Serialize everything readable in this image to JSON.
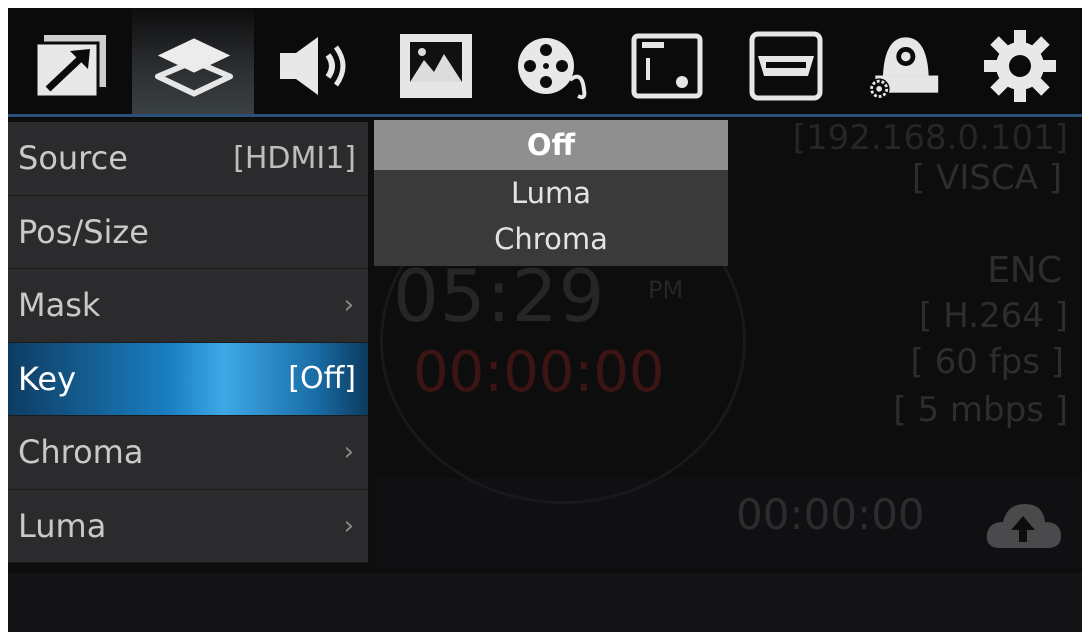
{
  "topbar": {
    "icons": [
      "window-icon",
      "layers-icon",
      "speaker-icon",
      "image-icon",
      "film-reel-icon",
      "monitor-icon",
      "hdmi-icon",
      "ptz-camera-icon",
      "gear-icon"
    ],
    "selected_index": 1
  },
  "menu": {
    "items": [
      {
        "label": "Source",
        "value": "[HDMI1]",
        "has_submenu": false
      },
      {
        "label": "Pos/Size",
        "value": "",
        "has_submenu": false
      },
      {
        "label": "Mask",
        "value": "",
        "has_submenu": true
      },
      {
        "label": "Key",
        "value": "[Off]",
        "has_submenu": false,
        "active": true
      },
      {
        "label": "Chroma",
        "value": "",
        "has_submenu": true
      },
      {
        "label": "Luma",
        "value": "",
        "has_submenu": true
      }
    ],
    "chevron": "›"
  },
  "dropdown": {
    "options": [
      "Off",
      "Luma",
      "Chroma"
    ],
    "selected": "Off"
  },
  "status": {
    "ip": "[192.168.0.101]",
    "protocol": "[ VISCA ]",
    "enc_label": "ENC",
    "codec": "[ H.264 ]",
    "fps": "[ 60 fps ]",
    "bitrate": "[ 5 mbps ]",
    "clock": "05:29",
    "ampm": "PM",
    "record_timer": "00:00:00",
    "stream_timer": "00:00:00"
  },
  "colors": {
    "accent": "#2a4f78",
    "active_item": "#1a7fc2",
    "record_red": "#3c1414"
  }
}
